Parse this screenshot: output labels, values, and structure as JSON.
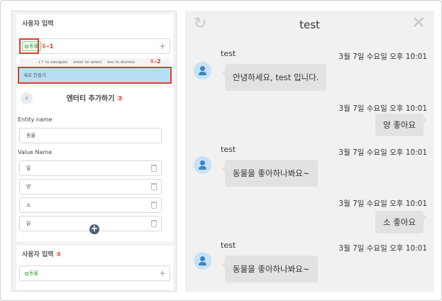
{
  "left": {
    "section1": {
      "title": "사용자 입력",
      "chip": "동물",
      "anno_chip": "①-1",
      "anno_new": "①-2",
      "hint": [
        "↓↑ to navigate",
        "enter to select",
        "esc to dismiss"
      ],
      "new_label": "새로 만들기"
    },
    "entity": {
      "title": "엔터티 추가하기",
      "anno": "②",
      "entity_name_label": "Entity name",
      "entity_name_value": "동물",
      "value_name_label": "Value Name",
      "values": [
        "말",
        "양",
        "소",
        "닭"
      ]
    },
    "section3": {
      "title": "사용자 입력",
      "anno": "③",
      "chip": "동물"
    }
  },
  "chat": {
    "title": "test",
    "messages": [
      {
        "side": "in",
        "sender": "test",
        "time": "3월 7일 수요일 오후 10:01",
        "text": "안녕하세요, test 입니다."
      },
      {
        "side": "out",
        "time": "3월 7일 수요일 오후 10:01",
        "text": "양 좋아요"
      },
      {
        "side": "in",
        "sender": "test",
        "time": "3월 7일 수요일 오후 10:01",
        "text": "동물을 좋아하나봐요~"
      },
      {
        "side": "out",
        "time": "3월 7일 수요일 오후 10:01",
        "text": "소 좋아요"
      },
      {
        "side": "in",
        "sender": "test",
        "time": "3월 7일 수요일 오후 10:01",
        "text": "동물을 좋아하나봐요~"
      }
    ]
  },
  "icons": {
    "refresh": "refresh-icon",
    "close": "close-icon",
    "avatar": "user-avatar-icon",
    "trash": "trash-icon",
    "plus": "plus-icon",
    "back": "chevron-left-icon"
  },
  "colors": {
    "annotation_red": "#e03b2c",
    "chip_green": "#2e9c3e",
    "selected_row": "#b9def3",
    "avatar_blue": "#3b85c4",
    "bubble_gray": "#e2e2e2"
  }
}
